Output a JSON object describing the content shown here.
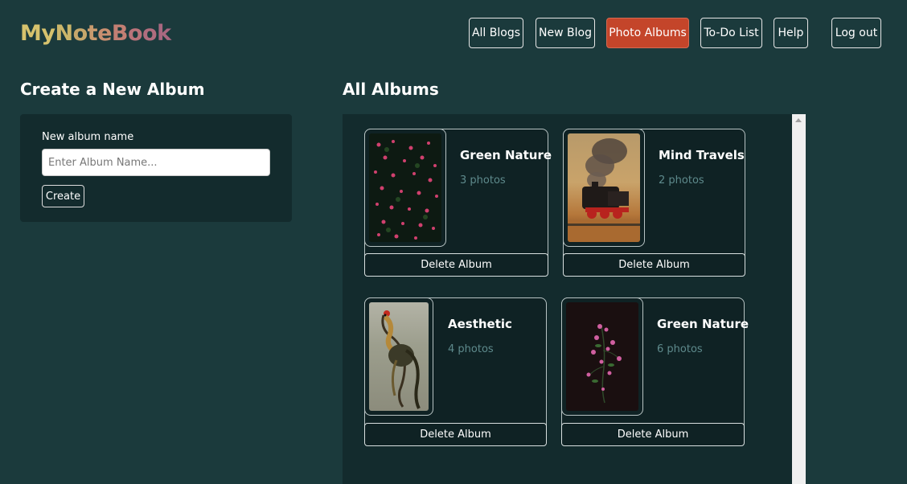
{
  "app": {
    "logo_letters": [
      "M",
      "y",
      "N",
      "o",
      "t",
      "e",
      "B",
      "o",
      "o",
      "k"
    ],
    "logo_colors": [
      "#d6c26d",
      "#d6c26d",
      "#c9b56a",
      "#c4a36b",
      "#c89a6e",
      "#c88f6f",
      "#c07d73",
      "#b8727a",
      "#b06c7e",
      "#a96880"
    ]
  },
  "nav": {
    "all_blogs": "All Blogs",
    "new_blog": "New Blog",
    "photo_albums": "Photo Albums",
    "todo_list": "To-Do List",
    "help": "Help",
    "logout": "Log out",
    "active_color": "#c4452a"
  },
  "create": {
    "title": "Create a New Album",
    "label": "New album name",
    "placeholder": "Enter Album Name...",
    "button": "Create"
  },
  "albums": {
    "title": "All Albums",
    "delete_label": "Delete Album",
    "items": [
      {
        "name": "Green Nature",
        "count": "3 photos",
        "thumb": "pink-flowers-icon"
      },
      {
        "name": "Mind Travels",
        "count": "2 photos",
        "thumb": "steam-train-icon"
      },
      {
        "name": "Aesthetic",
        "count": "4 photos",
        "thumb": "rooster-icon"
      },
      {
        "name": "Green Nature",
        "count": "6 photos",
        "thumb": "pink-flower-branch-icon"
      }
    ]
  },
  "colors": {
    "background": "#1b3a3c",
    "panel": "#132b2d",
    "muted_text": "#5e8a8c"
  }
}
